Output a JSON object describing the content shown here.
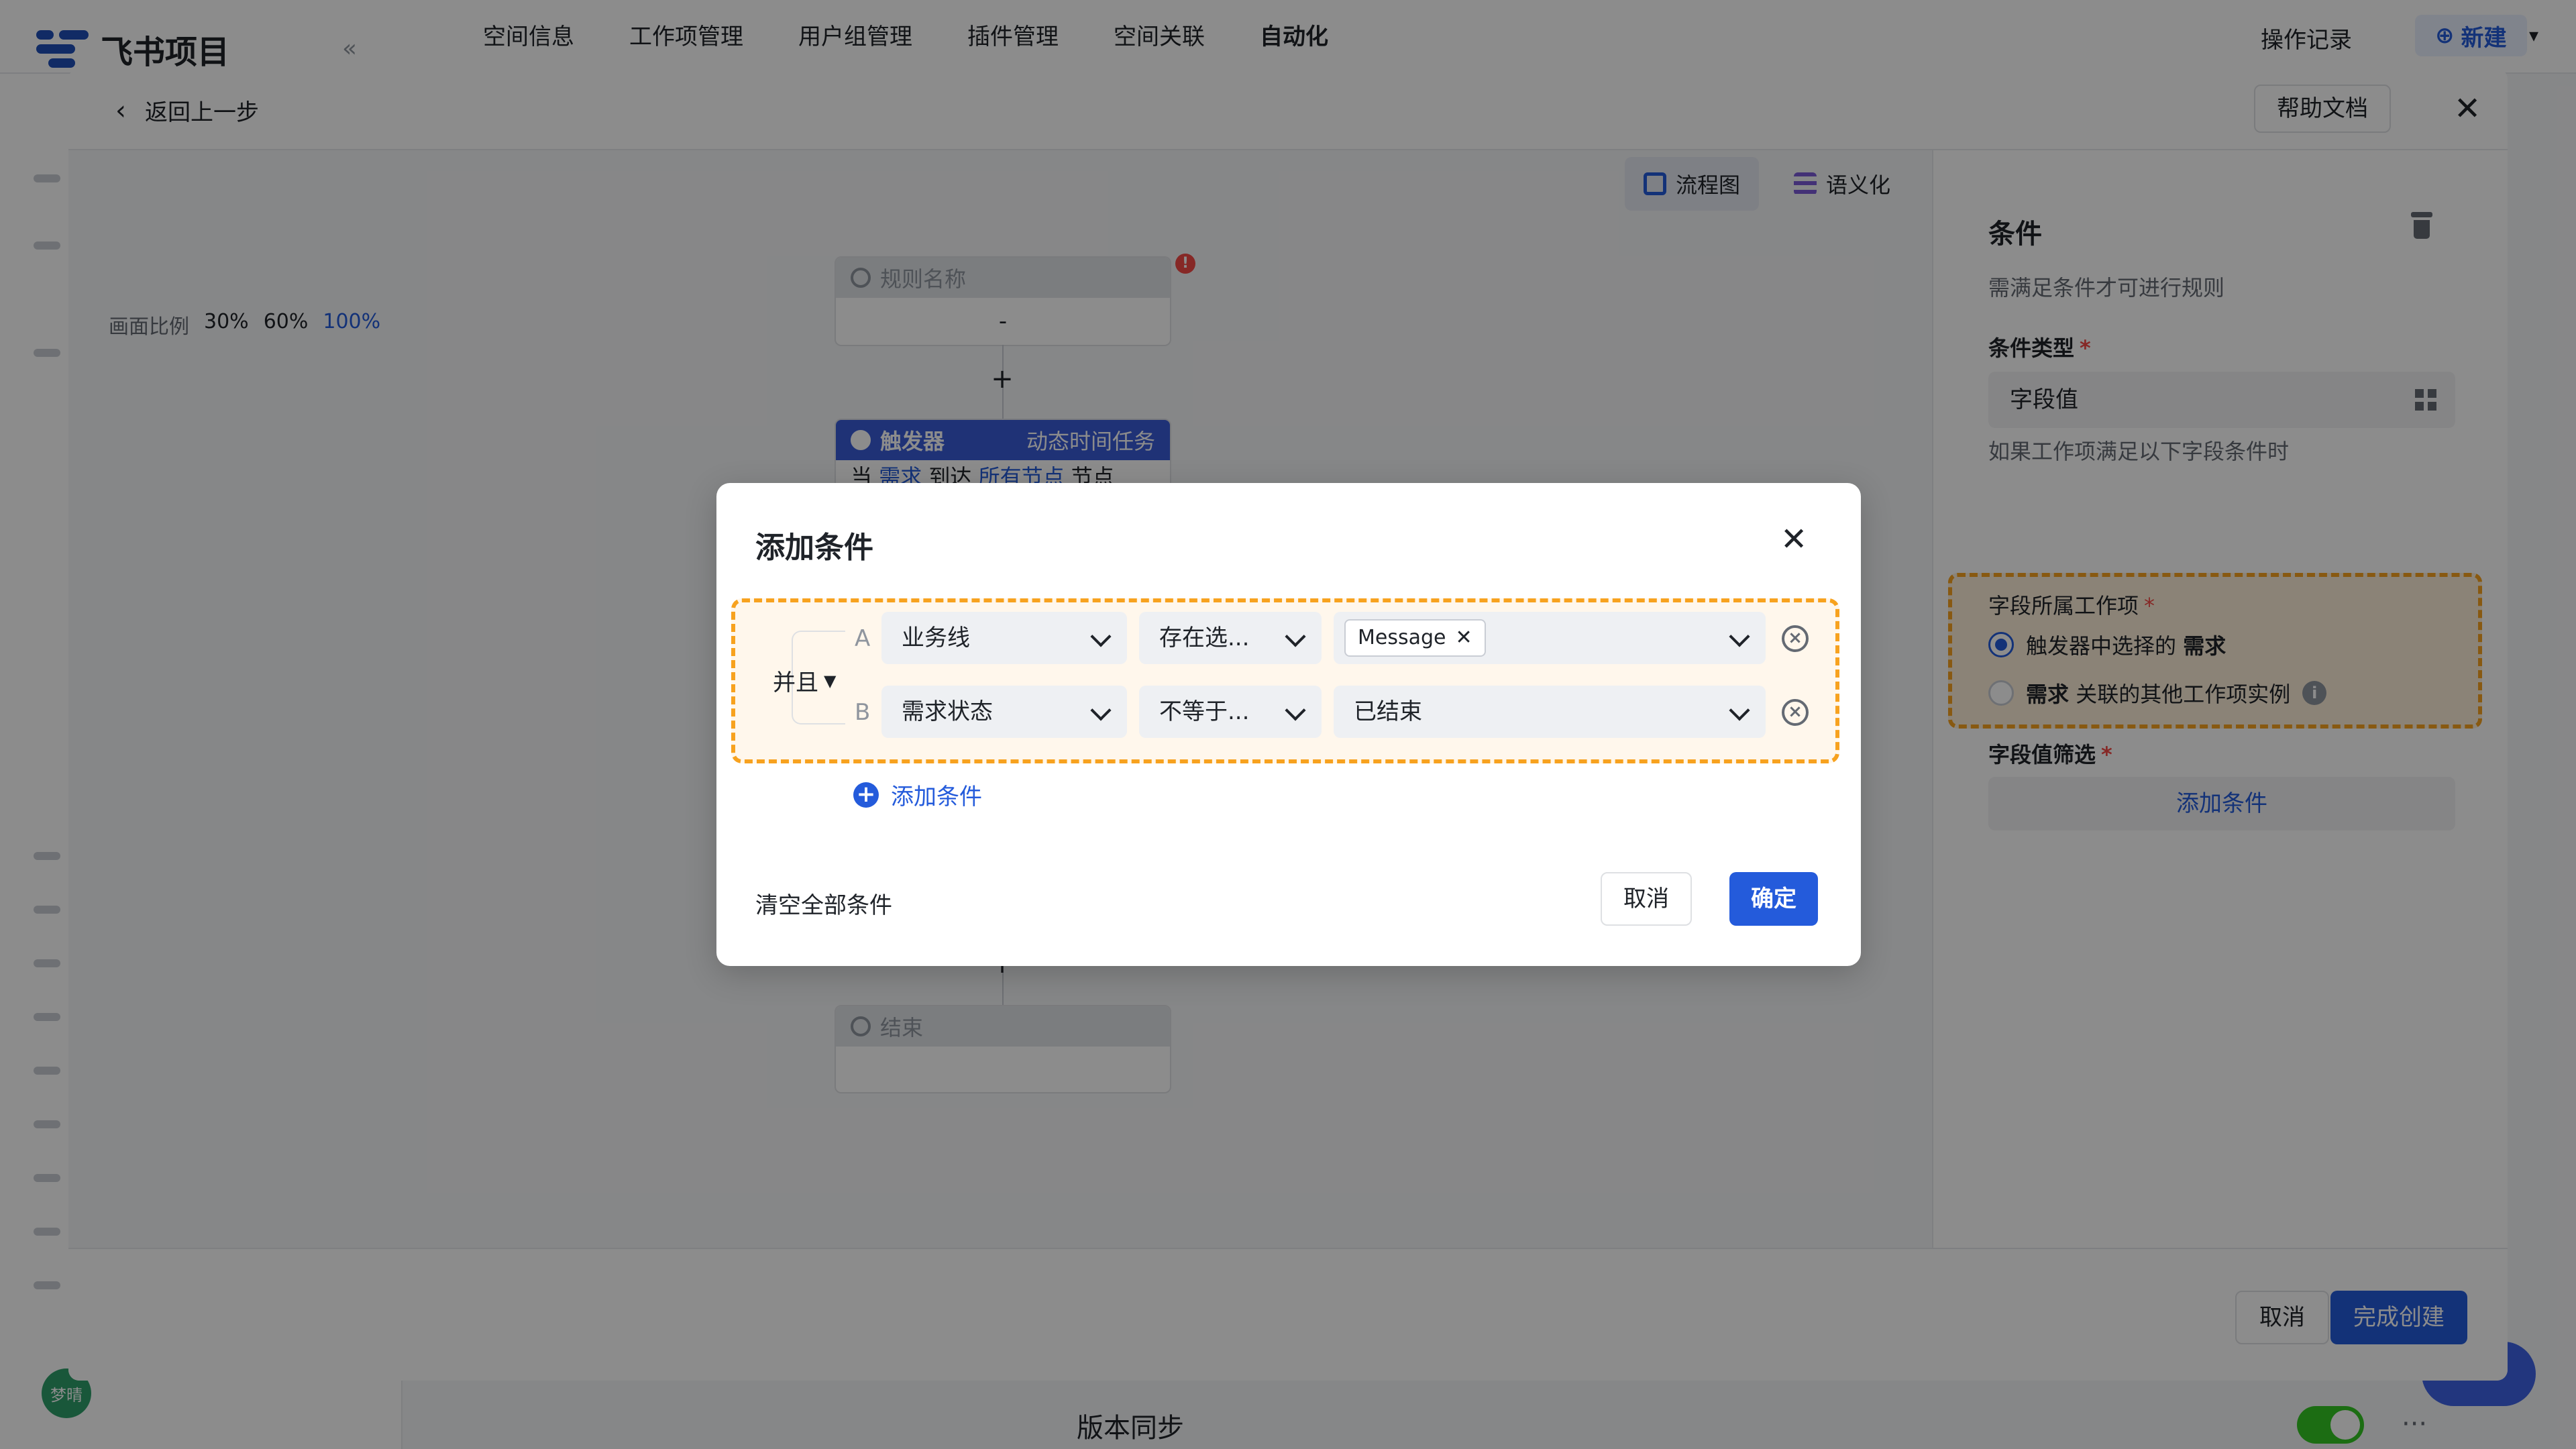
{
  "app": {
    "logo_text": "飞书项目",
    "nav": [
      "空间信息",
      "工作项管理",
      "用户组管理",
      "插件管理",
      "空间关联",
      "自动化"
    ],
    "nav_active": "自动化",
    "op_log": "操作记录",
    "new_label": "新建",
    "avatar_text": "梦晴",
    "bottom_section": "版本同步"
  },
  "editor": {
    "back_label": "返回上一步",
    "help_label": "帮助文档",
    "view_switch": {
      "flow": "流程图",
      "semantic": "语义化"
    },
    "zoom": {
      "label": "画面比例",
      "options": [
        "30%",
        "60%",
        "100%"
      ],
      "current": "100%"
    },
    "nodes": {
      "rule_name": {
        "title": "规则名称",
        "value": "-"
      },
      "trigger": {
        "title": "触发器",
        "subtitle": "动态时间任务",
        "body_prefix": "当",
        "body_item": "需求",
        "body_mid": "到达",
        "body_node": "所有节点",
        "body_suffix": "节点"
      },
      "end": {
        "title": "结束"
      }
    },
    "footer": {
      "cancel": "取消",
      "done": "完成创建"
    }
  },
  "right_panel": {
    "title": "条件",
    "desc": "需满足条件才可进行规则",
    "condition_type_label": "条件类型",
    "condition_type_value": "字段值",
    "hint": "如果工作项满足以下字段条件时",
    "field_item_label": "字段所属工作项",
    "radio_1_prefix": "触发器中选择的",
    "radio_1_bold": "需求",
    "radio_2_bold": "需求",
    "radio_2_suffix": "关联的其他工作项实例",
    "field_filter_label": "字段值筛选",
    "add_condition": "添加条件"
  },
  "modal": {
    "title": "添加条件",
    "logic": "并且",
    "rows": [
      {
        "letter": "A",
        "field": "业务线",
        "operator": "存在选...",
        "value_tag": "Message"
      },
      {
        "letter": "B",
        "field": "需求状态",
        "operator": "不等于...",
        "value": "已结束"
      }
    ],
    "add_condition": "添加条件",
    "clear_all": "清空全部条件",
    "cancel": "取消",
    "ok": "确定"
  },
  "colors": {
    "accent": "#245bdb",
    "highlight": "#f7a21f"
  }
}
